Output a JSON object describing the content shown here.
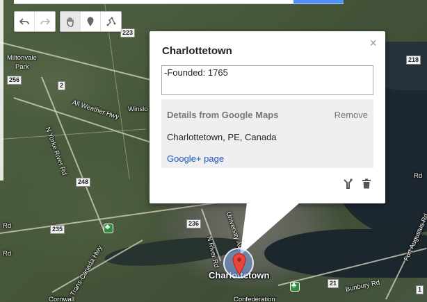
{
  "toolbar": {
    "buttons": [
      {
        "icon": "undo-icon"
      },
      {
        "icon": "redo-icon"
      },
      {
        "icon": "hand-icon"
      },
      {
        "icon": "add-marker-icon"
      },
      {
        "icon": "draw-line-icon"
      }
    ]
  },
  "info_window": {
    "title": "Charlottetown",
    "description": "-Founded: 1765",
    "details_heading": "Details from Google Maps",
    "remove_label": "Remove",
    "address": "Charlottetown, PE, Canada",
    "link_label": "Google+ page",
    "close_symbol": "×",
    "actions": [
      {
        "icon": "style-icon"
      },
      {
        "icon": "delete-icon"
      }
    ]
  },
  "map": {
    "labels": {
      "miltonvale": "Miltonvale",
      "park": "Park",
      "all_weather_hwy": "All Weather Hwy",
      "winslo": "Winslo",
      "n_yorke_river_rd": "N Yorke River Rd",
      "n_river_rd": "N River Rd",
      "university_ave": "University Ave",
      "trans_canada_hwy": "Trans-Canada Hwy",
      "charlottetown": "Charlottetown",
      "bunbury_rd": "Bunbury Rd",
      "fort_augustus_rd": "Fort Augustus Rd",
      "confederation": "Confederation",
      "cornwall": "Cornwall",
      "rd_left_top": "Rd",
      "rd_left_bottom": "Rd",
      "rd_right": "Rd"
    },
    "shields": {
      "s223": "223",
      "s256": "256",
      "s2": "2",
      "s248": "248",
      "s235": "235",
      "s236": "236",
      "s218": "218",
      "s21": "21",
      "s1": "1"
    }
  },
  "colors": {
    "link": "#1a55c4",
    "marker_red": "#e8453c"
  }
}
